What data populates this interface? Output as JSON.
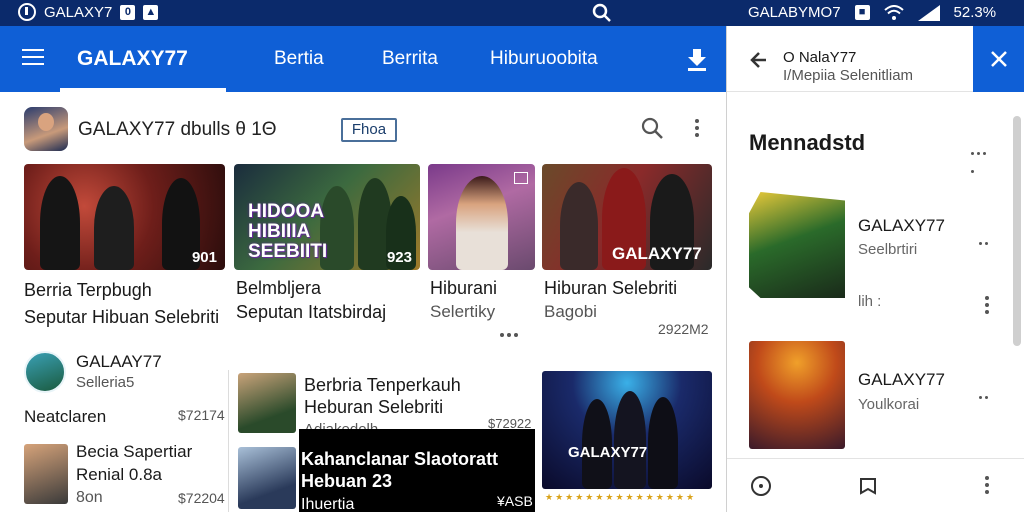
{
  "status_bar": {
    "app_name": "GALAXY7",
    "sq1": "0",
    "center_name": "GALABYMO7",
    "battery": "52.3%"
  },
  "app_bar": {
    "brand": "GALAXY77",
    "tabs": [
      "Bertia",
      "Berrita",
      "Hiburuoobita"
    ]
  },
  "channel": {
    "title": "GALAXY77  dbulls θ 1Θ",
    "badge": "Fhoa"
  },
  "top_videos": [
    {
      "title": "Berria Terpbugh",
      "subtitle": "Seputar Hibuan Selebriti",
      "duration": "901"
    },
    {
      "title": "Belmbljera",
      "subtitle": "Seputan Itatsbirdaj",
      "duration": "923",
      "overlay": "HIDOOA HIBIIIA SEEBIITI"
    },
    {
      "title": "Hiburani",
      "subtitle": "Selertiky",
      "duration": ""
    },
    {
      "title": "Hiburan Selebriti",
      "subtitle": "Bagobi",
      "meta": "2922M2",
      "overlay": "GALAXY77"
    }
  ],
  "lower_left": [
    {
      "name": "GALAAY77",
      "subtitle": "Selleria5"
    },
    {
      "title": "Neatclaren",
      "meta": "$72174"
    },
    {
      "title": "Becia Sapertiar",
      "subtitle": "Renial 0.8a",
      "detail": "8on",
      "meta": "$72204"
    }
  ],
  "middle_list": [
    {
      "title": "Berbria Tenperkauh",
      "subtitle": "Heburan Selebriti",
      "detail": "Adiakedolh",
      "meta": "$72922"
    },
    {
      "title": "Kahanclanar Slaotoratt",
      "subtitle": "Hebuan 23",
      "detail": "Ihuertia",
      "meta": "¥ASB"
    }
  ],
  "concert": {
    "label": "GALAXY77"
  },
  "right_panel": {
    "header_title": "O NalaY77",
    "header_sub": "I/Mepiia Selenitliam",
    "section_title": "Mennadstd",
    "items": [
      {
        "name": "GALAXY77",
        "subtitle": "Seelbrtiri",
        "meta": "lih :"
      },
      {
        "name": "GALAXY77",
        "subtitle": "Youlkorai"
      }
    ]
  }
}
